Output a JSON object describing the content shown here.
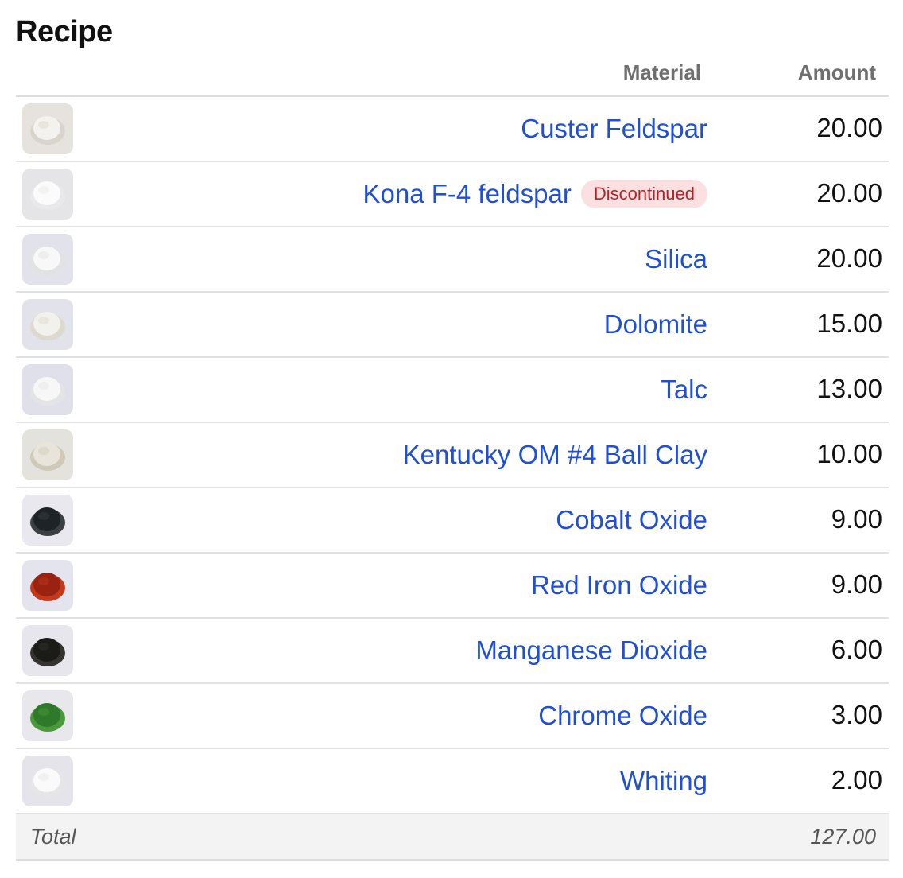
{
  "title": "Recipe",
  "columns": {
    "material": "Material",
    "amount": "Amount"
  },
  "rows": [
    {
      "name": "Custer Feldspar",
      "amount": "20.00",
      "badge": "",
      "bg": "#e6e3df",
      "powder": "#f4f2ee",
      "shade": "#d9d5cc",
      "icon": "custer-feldspar-powder-icon"
    },
    {
      "name": "Kona F-4 feldspar",
      "amount": "20.00",
      "badge": "Discontinued",
      "bg": "#e5e5e8",
      "powder": "#fbfbfb",
      "shade": "#e9e9ec",
      "icon": "kona-f4-feldspar-powder-icon"
    },
    {
      "name": "Silica",
      "amount": "20.00",
      "badge": "",
      "bg": "#e2e2ea",
      "powder": "#f8f8f8",
      "shade": "#e2e2e4",
      "icon": "silica-powder-icon"
    },
    {
      "name": "Dolomite",
      "amount": "15.00",
      "badge": "",
      "bg": "#e2e2ea",
      "powder": "#f3f1ec",
      "shade": "#ddd9d0",
      "icon": "dolomite-powder-icon"
    },
    {
      "name": "Talc",
      "amount": "13.00",
      "badge": "",
      "bg": "#dfe0ea",
      "powder": "#f7f7f7",
      "shade": "#e4e4e6",
      "icon": "talc-powder-icon"
    },
    {
      "name": "Kentucky OM #4 Ball Clay",
      "amount": "10.00",
      "badge": "",
      "bg": "#e4e2dd",
      "powder": "#e8e4d9",
      "shade": "#cfc9b8",
      "icon": "ball-clay-powder-icon"
    },
    {
      "name": "Cobalt Oxide",
      "amount": "9.00",
      "badge": "",
      "bg": "#e8e8ee",
      "powder": "#1e2326",
      "shade": "#3a4044",
      "icon": "cobalt-oxide-powder-icon"
    },
    {
      "name": "Red Iron Oxide",
      "amount": "9.00",
      "badge": "",
      "bg": "#e4e4ee",
      "powder": "#9a2210",
      "shade": "#c23a1a",
      "icon": "red-iron-oxide-powder-icon"
    },
    {
      "name": "Manganese Dioxide",
      "amount": "6.00",
      "badge": "",
      "bg": "#e6e6ec",
      "powder": "#1b1b18",
      "shade": "#34332d",
      "icon": "manganese-dioxide-powder-icon"
    },
    {
      "name": "Chrome Oxide",
      "amount": "3.00",
      "badge": "",
      "bg": "#e8e8ec",
      "powder": "#2f7a2a",
      "shade": "#4a9a3c",
      "icon": "chrome-oxide-powder-icon"
    },
    {
      "name": "Whiting",
      "amount": "2.00",
      "badge": "",
      "bg": "#e4e4ea",
      "powder": "#fafafa",
      "shade": "#e6e6e8",
      "icon": "whiting-powder-icon"
    }
  ],
  "total": {
    "label": "Total",
    "value": "127.00"
  },
  "colors": {
    "link": "#1f4fd6",
    "badge_text": "#b3222a",
    "badge_bg": "#fbe0e2"
  }
}
